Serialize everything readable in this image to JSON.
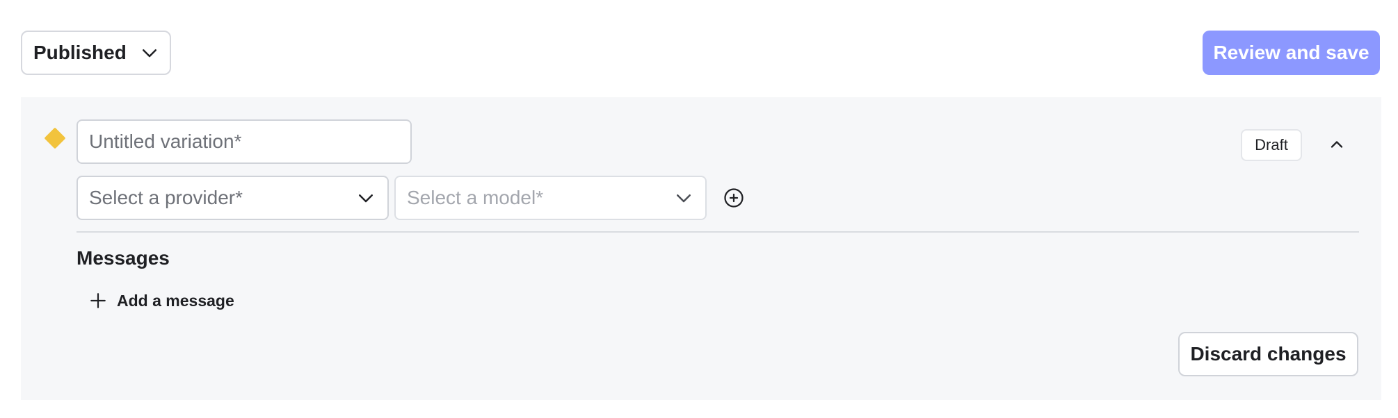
{
  "header": {
    "status_select": {
      "value": "Published",
      "icon": "chevron-down-icon"
    },
    "review_button_label": "Review and save",
    "accent_color": "#8c98ff"
  },
  "variation": {
    "status_color": "#f2c33d",
    "name_input": {
      "value": "",
      "placeholder": "Untitled variation*"
    },
    "badge": "Draft",
    "collapse_icon": "chevron-up-icon",
    "provider_select": {
      "placeholder": "Select a provider*",
      "icon": "chevron-down-icon"
    },
    "model_select": {
      "placeholder": "Select a model*",
      "icon": "chevron-down-icon"
    },
    "add_icon": "plus-circle-icon",
    "messages": {
      "heading": "Messages",
      "add_label": "Add a message",
      "add_icon": "plus-icon"
    },
    "discard_label": "Discard changes"
  }
}
